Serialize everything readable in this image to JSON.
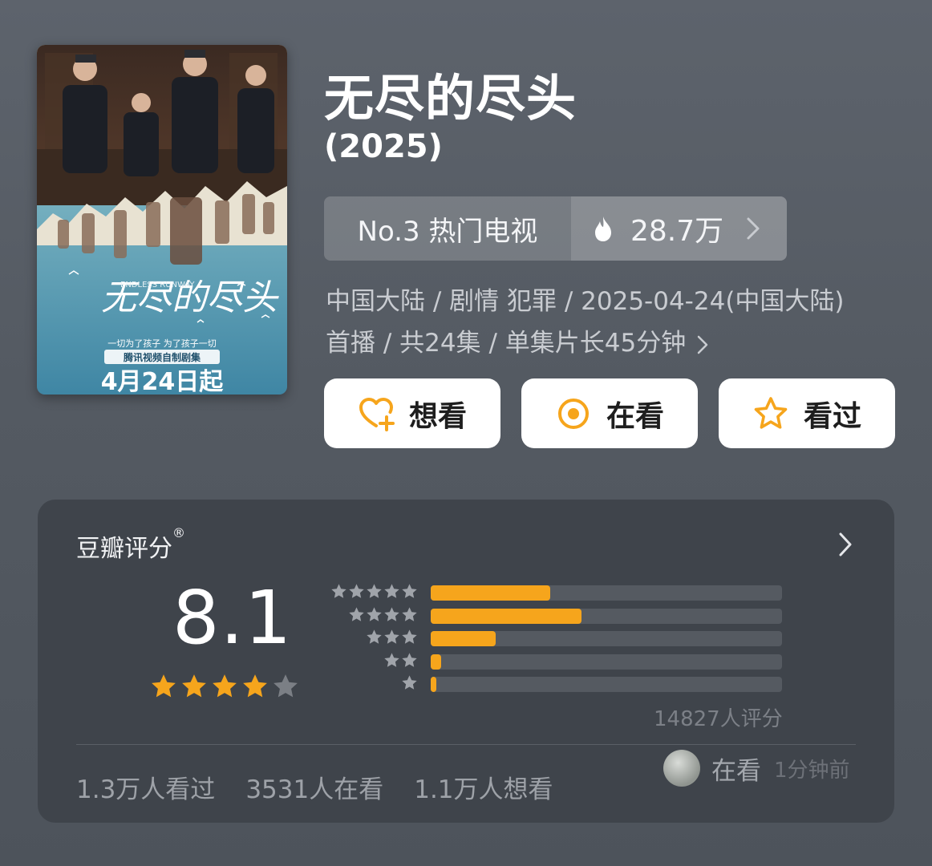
{
  "poster": {
    "script_title": "无尽的尽头",
    "english_title": "ENDLESS RUNWAY",
    "tagline": "一切为了孩子 为了孩子一切",
    "badge": "腾讯视频自制剧集",
    "release_banner": "4月24日起"
  },
  "header": {
    "title": "无尽的尽头",
    "year": "(2025)"
  },
  "rank": {
    "label": "No.3 热门电视",
    "heat": "28.7万",
    "icons": {
      "heat": "flame-icon",
      "more": "chevron-right-icon"
    }
  },
  "meta": {
    "line1": "中国大陆 / 剧情 犯罪 / 2025-04-24(中国大陆)",
    "line2": "首播 / 共24集 / 单集片长45分钟"
  },
  "actions": {
    "want": "想看",
    "watching": "在看",
    "watched": "看过"
  },
  "rating": {
    "title": "豆瓣评分",
    "registered_mark": "®",
    "score": "8.1",
    "score_stars": 4,
    "distribution": [
      {
        "stars": 5,
        "fraction": 0.34
      },
      {
        "stars": 4,
        "fraction": 0.43
      },
      {
        "stars": 3,
        "fraction": 0.185
      },
      {
        "stars": 2,
        "fraction": 0.03
      },
      {
        "stars": 1,
        "fraction": 0.015
      }
    ],
    "count": "14827人评分",
    "stats": {
      "watched": "1.3万人看过",
      "watching": "3531人在看",
      "want": "1.1万人想看"
    },
    "recent_activity": {
      "status": "在看",
      "time": "1分钟前"
    }
  },
  "colors": {
    "accent": "#f6a51c",
    "background": "#575d65",
    "card": "#3f444b"
  }
}
